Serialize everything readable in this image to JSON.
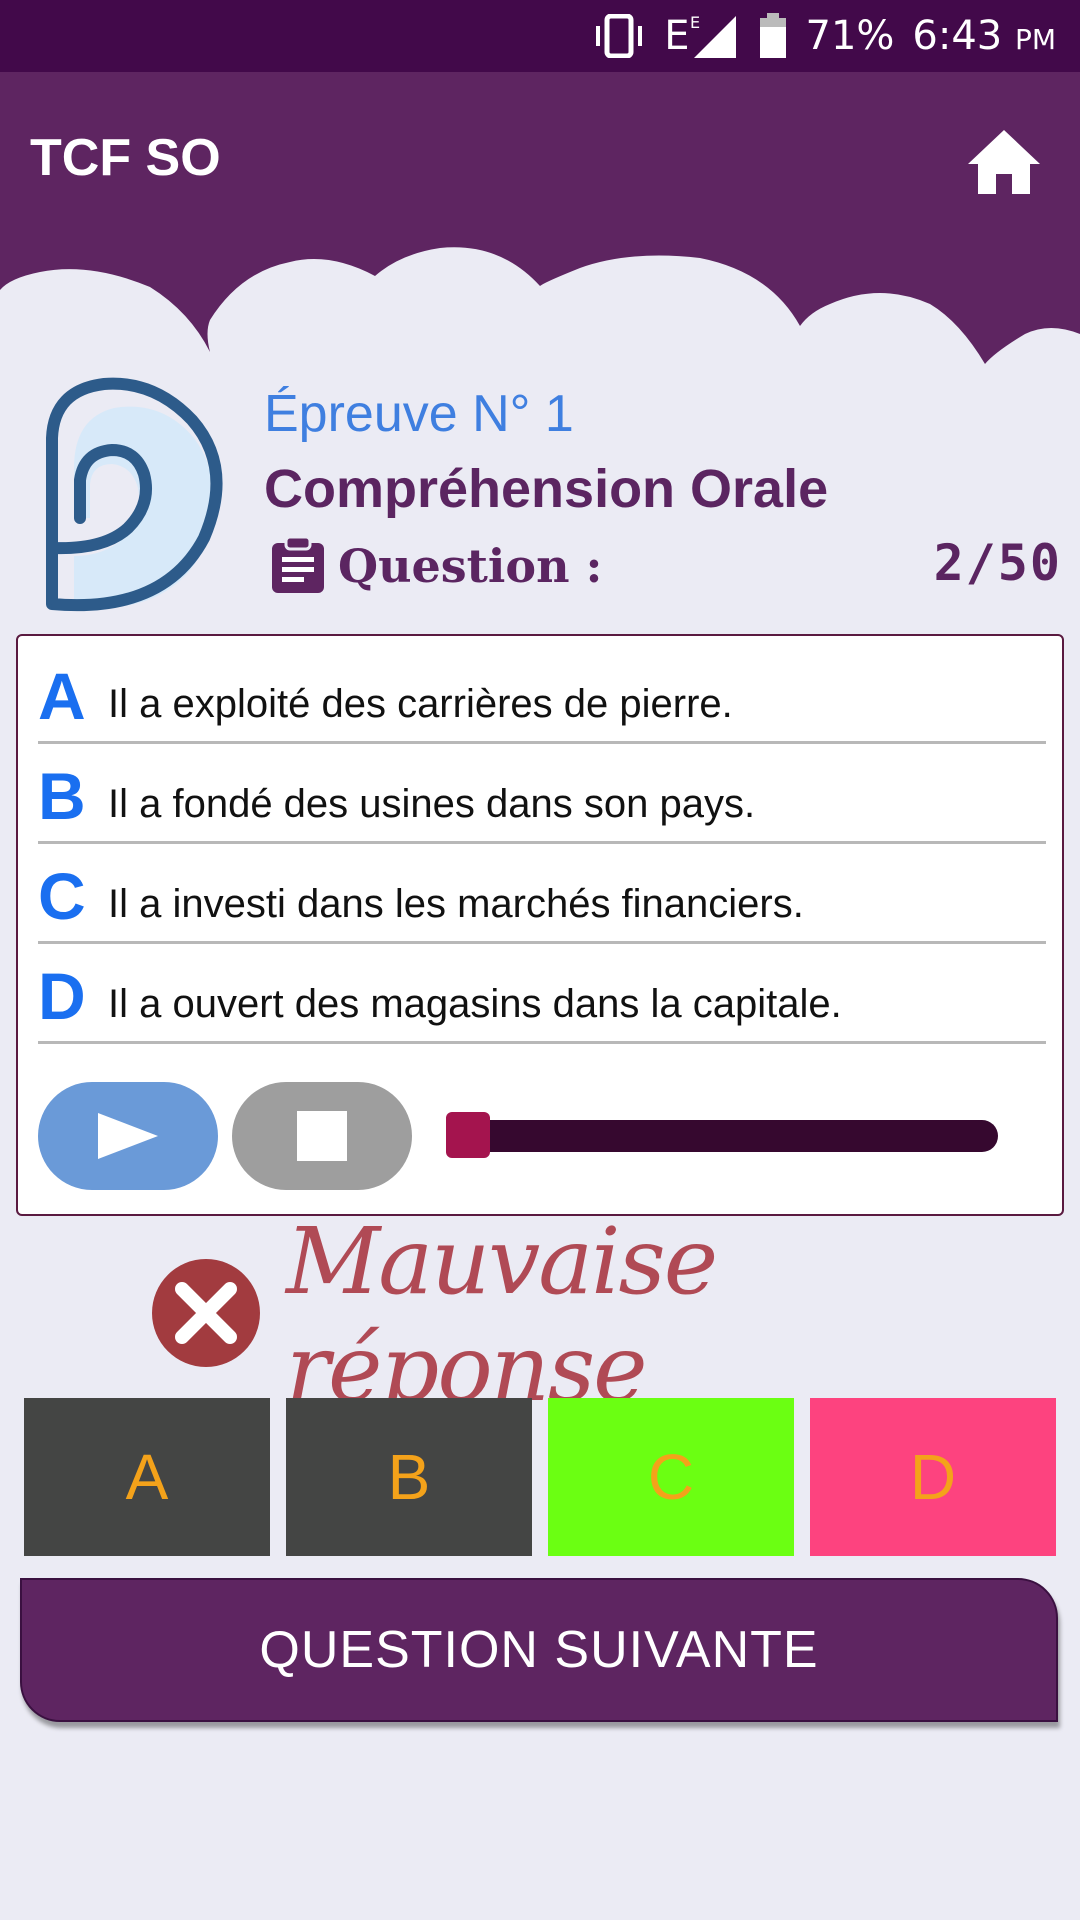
{
  "status_bar": {
    "battery_percent": "71%",
    "time": "6:43",
    "am_pm": "PM",
    "network": "E"
  },
  "app": {
    "title": "TCF SO"
  },
  "heading": {
    "epreuve": "Épreuve N° 1",
    "section": "Compréhension Orale",
    "question_label": "Question :",
    "question_counter": "2/50"
  },
  "options": [
    {
      "letter": "A",
      "text": "Il a exploité des carrières de pierre."
    },
    {
      "letter": "B",
      "text": "Il a fondé des usines dans son pays."
    },
    {
      "letter": "C",
      "text": "Il a investi dans les marchés financiers."
    },
    {
      "letter": "D",
      "text": "Il a ouvert des magasins dans la capitale."
    }
  ],
  "audio": {
    "progress": 0.0
  },
  "result": {
    "text": "Mauvaise réponse",
    "icon": "wrong-answer-icon"
  },
  "choices": [
    {
      "letter": "A",
      "color": "#444544"
    },
    {
      "letter": "B",
      "color": "#444544"
    },
    {
      "letter": "C",
      "color": "#6bff12"
    },
    {
      "letter": "D",
      "color": "#fd437f"
    }
  ],
  "next_button": {
    "label": "QUESTION SUIVANTE"
  },
  "colors": {
    "primary": "#5e2561",
    "status_bar": "#42094a",
    "option_letter": "#1a6ff0",
    "choice_text": "#f4a21a"
  }
}
